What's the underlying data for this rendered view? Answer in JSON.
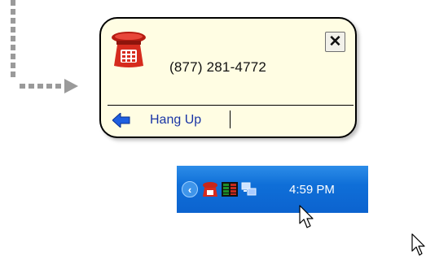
{
  "notification": {
    "phone_number": "(877) 281-4772",
    "close_label": "✕",
    "hangup_label": "Hang Up"
  },
  "taskbar": {
    "clock": "4:59 PM",
    "tray_icons": [
      "show-hidden-icon",
      "red-telephone-icon",
      "network-activity-icon",
      "network-connections-icon"
    ]
  },
  "colors": {
    "popup_background": "#fffde3",
    "link_blue": "#1a35a6",
    "taskbar_blue": "#0c63cf",
    "phone_red": "#d62b1e"
  }
}
